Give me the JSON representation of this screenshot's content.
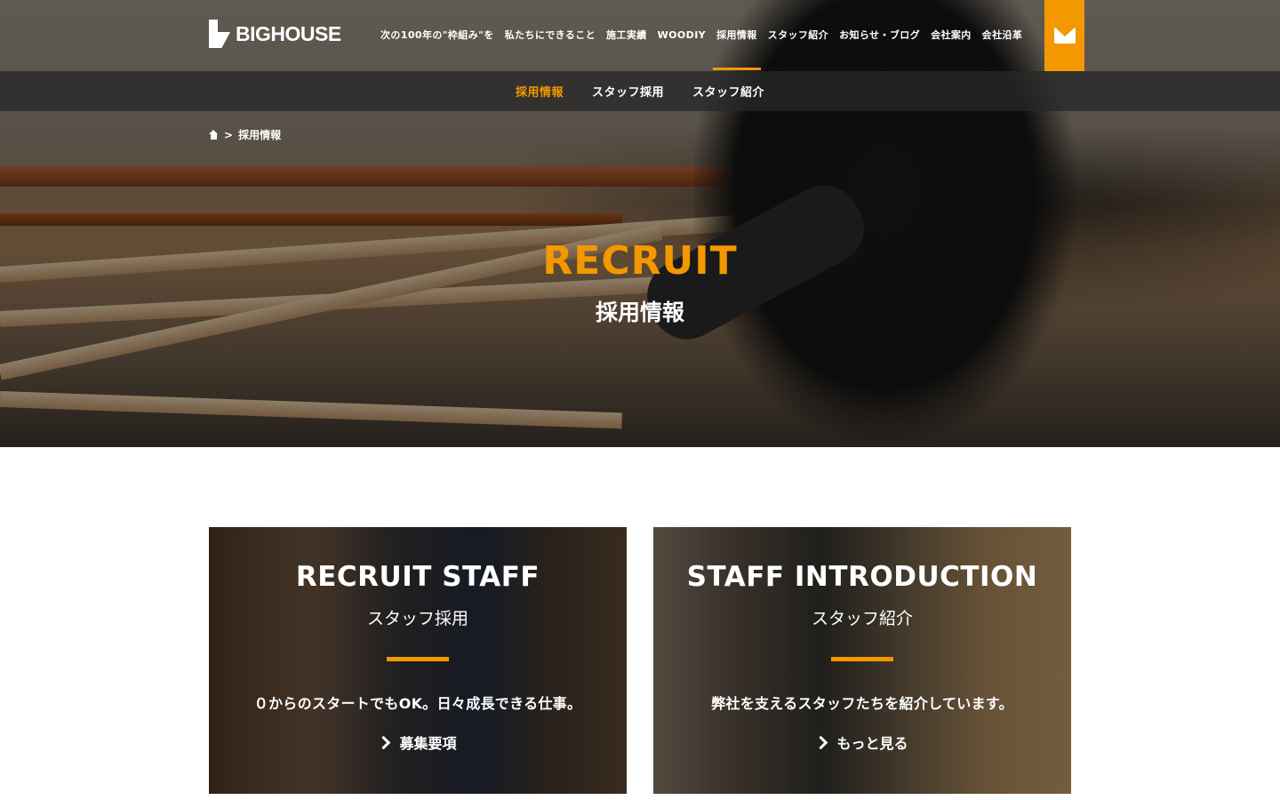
{
  "header": {
    "logo_text": "BIGHOUSE",
    "nav": [
      {
        "label": "次の100年の\"枠組み\"を"
      },
      {
        "label": "私たちにできること"
      },
      {
        "label": "施工実績"
      },
      {
        "label": "WOODIY"
      },
      {
        "label": "採用情報"
      },
      {
        "label": "スタッフ紹介"
      },
      {
        "label": "お知らせ・ブログ"
      },
      {
        "label": "会社案内"
      },
      {
        "label": "会社沿革"
      }
    ],
    "active_nav": "採用情報",
    "mail_icon": "mail-icon"
  },
  "subnav": [
    {
      "label": "採用情報"
    },
    {
      "label": "スタッフ採用"
    },
    {
      "label": "スタッフ紹介"
    }
  ],
  "breadcrumb": {
    "sep": ">",
    "current": "採用情報"
  },
  "hero": {
    "title": "RECRUIT",
    "subtitle": "採用情報"
  },
  "cards": [
    {
      "title": "RECRUIT STAFF",
      "subtitle": "スタッフ採用",
      "description": "０からのスタートでもOK。日々成長できる仕事。",
      "link": "募集要項"
    },
    {
      "title": "STAFF INTRODUCTION",
      "subtitle": "スタッフ紹介",
      "description": "弊社を支えるスタッフたちを紹介しています。",
      "link": "もっと見る"
    }
  ],
  "colors": {
    "accent": "#f39800",
    "subnav_bg": "#282828"
  }
}
